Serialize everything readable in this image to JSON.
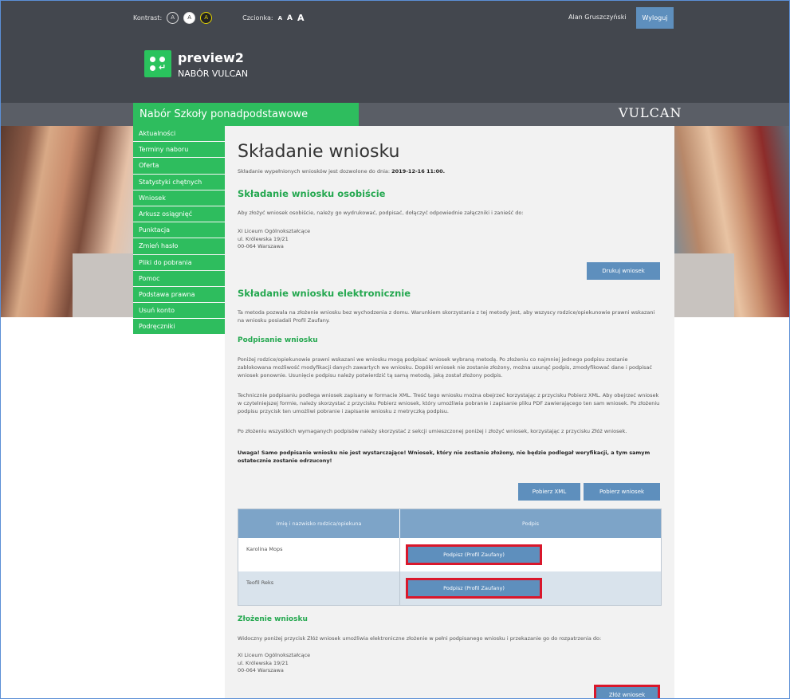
{
  "header": {
    "contrast_label": "Kontrast:",
    "contrast_options": [
      "A",
      "A",
      "A"
    ],
    "font_label": "Czcionka:",
    "font_sizes": [
      "A",
      "A",
      "A"
    ],
    "user_name": "Alan Gruszczyński",
    "logout_label": "Wyloguj",
    "app_title": "preview2",
    "app_subtitle": "NABÓR VULCAN"
  },
  "nav": {
    "title": "Nabór Szkoły ponadpodstawowe",
    "brand": "VULCAN"
  },
  "sidebar": {
    "items": [
      {
        "label": "Aktualności"
      },
      {
        "label": "Terminy naboru"
      },
      {
        "label": "Oferta"
      },
      {
        "label": "Statystyki chętnych"
      },
      {
        "label": "Wniosek"
      },
      {
        "label": "Arkusz osiągnięć"
      },
      {
        "label": "Punktacja"
      },
      {
        "label": "Zmień hasło"
      },
      {
        "label": "Pliki do pobrania"
      },
      {
        "label": "Pomoc"
      },
      {
        "label": "Podstawa prawna"
      },
      {
        "label": "Usuń konto"
      },
      {
        "label": "Podręczniki"
      }
    ]
  },
  "main": {
    "title": "Składanie wniosku",
    "deadline_text": "Składanie wypełnionych wniosków jest dozwolone do dnia:",
    "deadline_value": "2019-12-16 11:00.",
    "personal": {
      "heading": "Składanie wniosku osobiście",
      "text": "Aby złożyć wniosek osobiście, należy go wydrukować, podpisać, dołączyć odpowiednie załączniki i zanieść do:",
      "address": [
        "XI Liceum Ogólnokształcące",
        "ul. Królewska 19/21",
        "00-064 Warszawa"
      ],
      "print_button": "Drukuj wniosek"
    },
    "electronic": {
      "heading": "Składanie wniosku elektronicznie",
      "text": "Ta metoda pozwala na złożenie wniosku bez wychodzenia z domu. Warunkiem skorzystania z tej metody jest, aby wszyscy rodzice/opiekunowie prawni wskazani na wniosku posiadali Profil Zaufany."
    },
    "signing": {
      "heading": "Podpisanie wniosku",
      "p1": "Poniżej rodzice/opiekunowie prawni wskazani we wniosku mogą podpisać wniosek wybraną metodą. Po złożeniu co najmniej jednego podpisu zostanie zablokowana możliwość modyfikacji danych zawartych we wniosku. Dopóki wniosek nie zostanie złożony, można usunąć podpis, zmodyfikować dane i podpisać wniosek ponownie. Usunięcie podpisu należy potwierdzić tą samą metodą, jaką został złożony podpis.",
      "p2": "Technicznie podpisaniu podlega wniosek zapisany w formacie XML. Treść tego wniosku można obejrzeć korzystając z przycisku Pobierz XML. Aby obejrzeć wniosek w czytelniejszej formie, należy skorzystać z przycisku Pobierz wniosek, który umożliwia pobranie i zapisanie pliku PDF zawierającego ten sam wniosek. Po złożeniu podpisu przycisk ten umożliwi pobranie i zapisanie wniosku z metryczką podpisu.",
      "p3": "Po złożeniu wszystkich wymaganych podpisów należy skorzystać z sekcji umieszczonej poniżej i złożyć wniosek, korzystając z przycisku Złóż wniosek.",
      "warning": "Uwaga! Samo podpisanie wniosku nie jest wystarczające! Wniosek, który nie zostanie złożony, nie będzie podlegał weryfikacji, a tym samym ostatecznie zostanie odrzucony!",
      "xml_button": "Pobierz XML",
      "download_button": "Pobierz wniosek"
    },
    "table": {
      "headers": [
        "Imię i nazwisko rodzica/opiekuna",
        "Podpis"
      ],
      "rows": [
        {
          "name": "Karolina Mops",
          "action": "Podpisz (Profil Zaufany)"
        },
        {
          "name": "Teofil Reks",
          "action": "Podpisz (Profil Zaufany)"
        }
      ]
    },
    "submit": {
      "heading": "Złożenie wniosku",
      "text": "Widoczny poniżej przycisk Złóż wniosek umożliwia elektroniczne złożenie w pełni podpisanego wniosku i przekazanie go do rozpatrzenia do:",
      "address": [
        "XI Liceum Ogólnokształcące",
        "ul. Królewska 19/21",
        "00-064 Warszawa"
      ],
      "submit_button": "Złóż wniosek"
    }
  },
  "colors": {
    "green": "#2ebd5e",
    "header_dark": "#43474e",
    "button_blue": "#5e8fbd",
    "highlight_red": "#d9172b"
  }
}
